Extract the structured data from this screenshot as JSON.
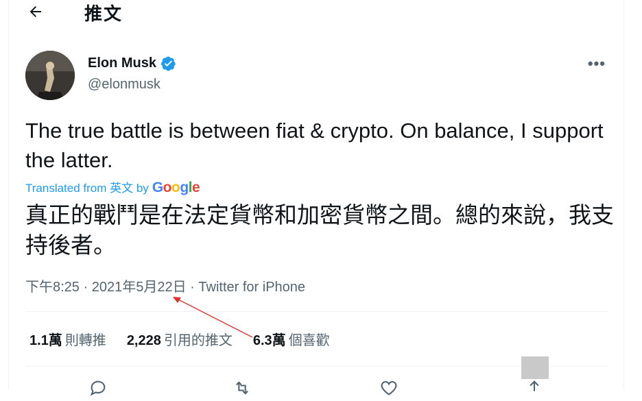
{
  "header": {
    "title": "推文"
  },
  "author": {
    "name": "Elon Musk",
    "handle": "@elonmusk"
  },
  "tweet": {
    "text": "The true battle is between fiat & crypto. On balance, I support the latter.",
    "translated_from": "Translated from 英文 by",
    "translator": "Google",
    "translation": "真正的戰鬥是在法定貨幣和加密貨幣之間。總的來說，我支持後者。",
    "time": "下午8:25",
    "date": "2021年5月22日",
    "source": "Twitter for iPhone",
    "separator": "·"
  },
  "stats": [
    {
      "value": "1.1萬",
      "label": "則轉推"
    },
    {
      "value": "2,228",
      "label": "引用的推文"
    },
    {
      "value": "6.3萬",
      "label": "個喜歡"
    }
  ],
  "icons": [
    "back-arrow-icon",
    "verified-badge-icon",
    "more-options-icon",
    "reply-icon",
    "retweet-icon",
    "like-icon",
    "share-icon"
  ],
  "colors": {
    "accent": "#1d9bf0",
    "secondary_text": "#536471",
    "annotation": "#e03030"
  }
}
